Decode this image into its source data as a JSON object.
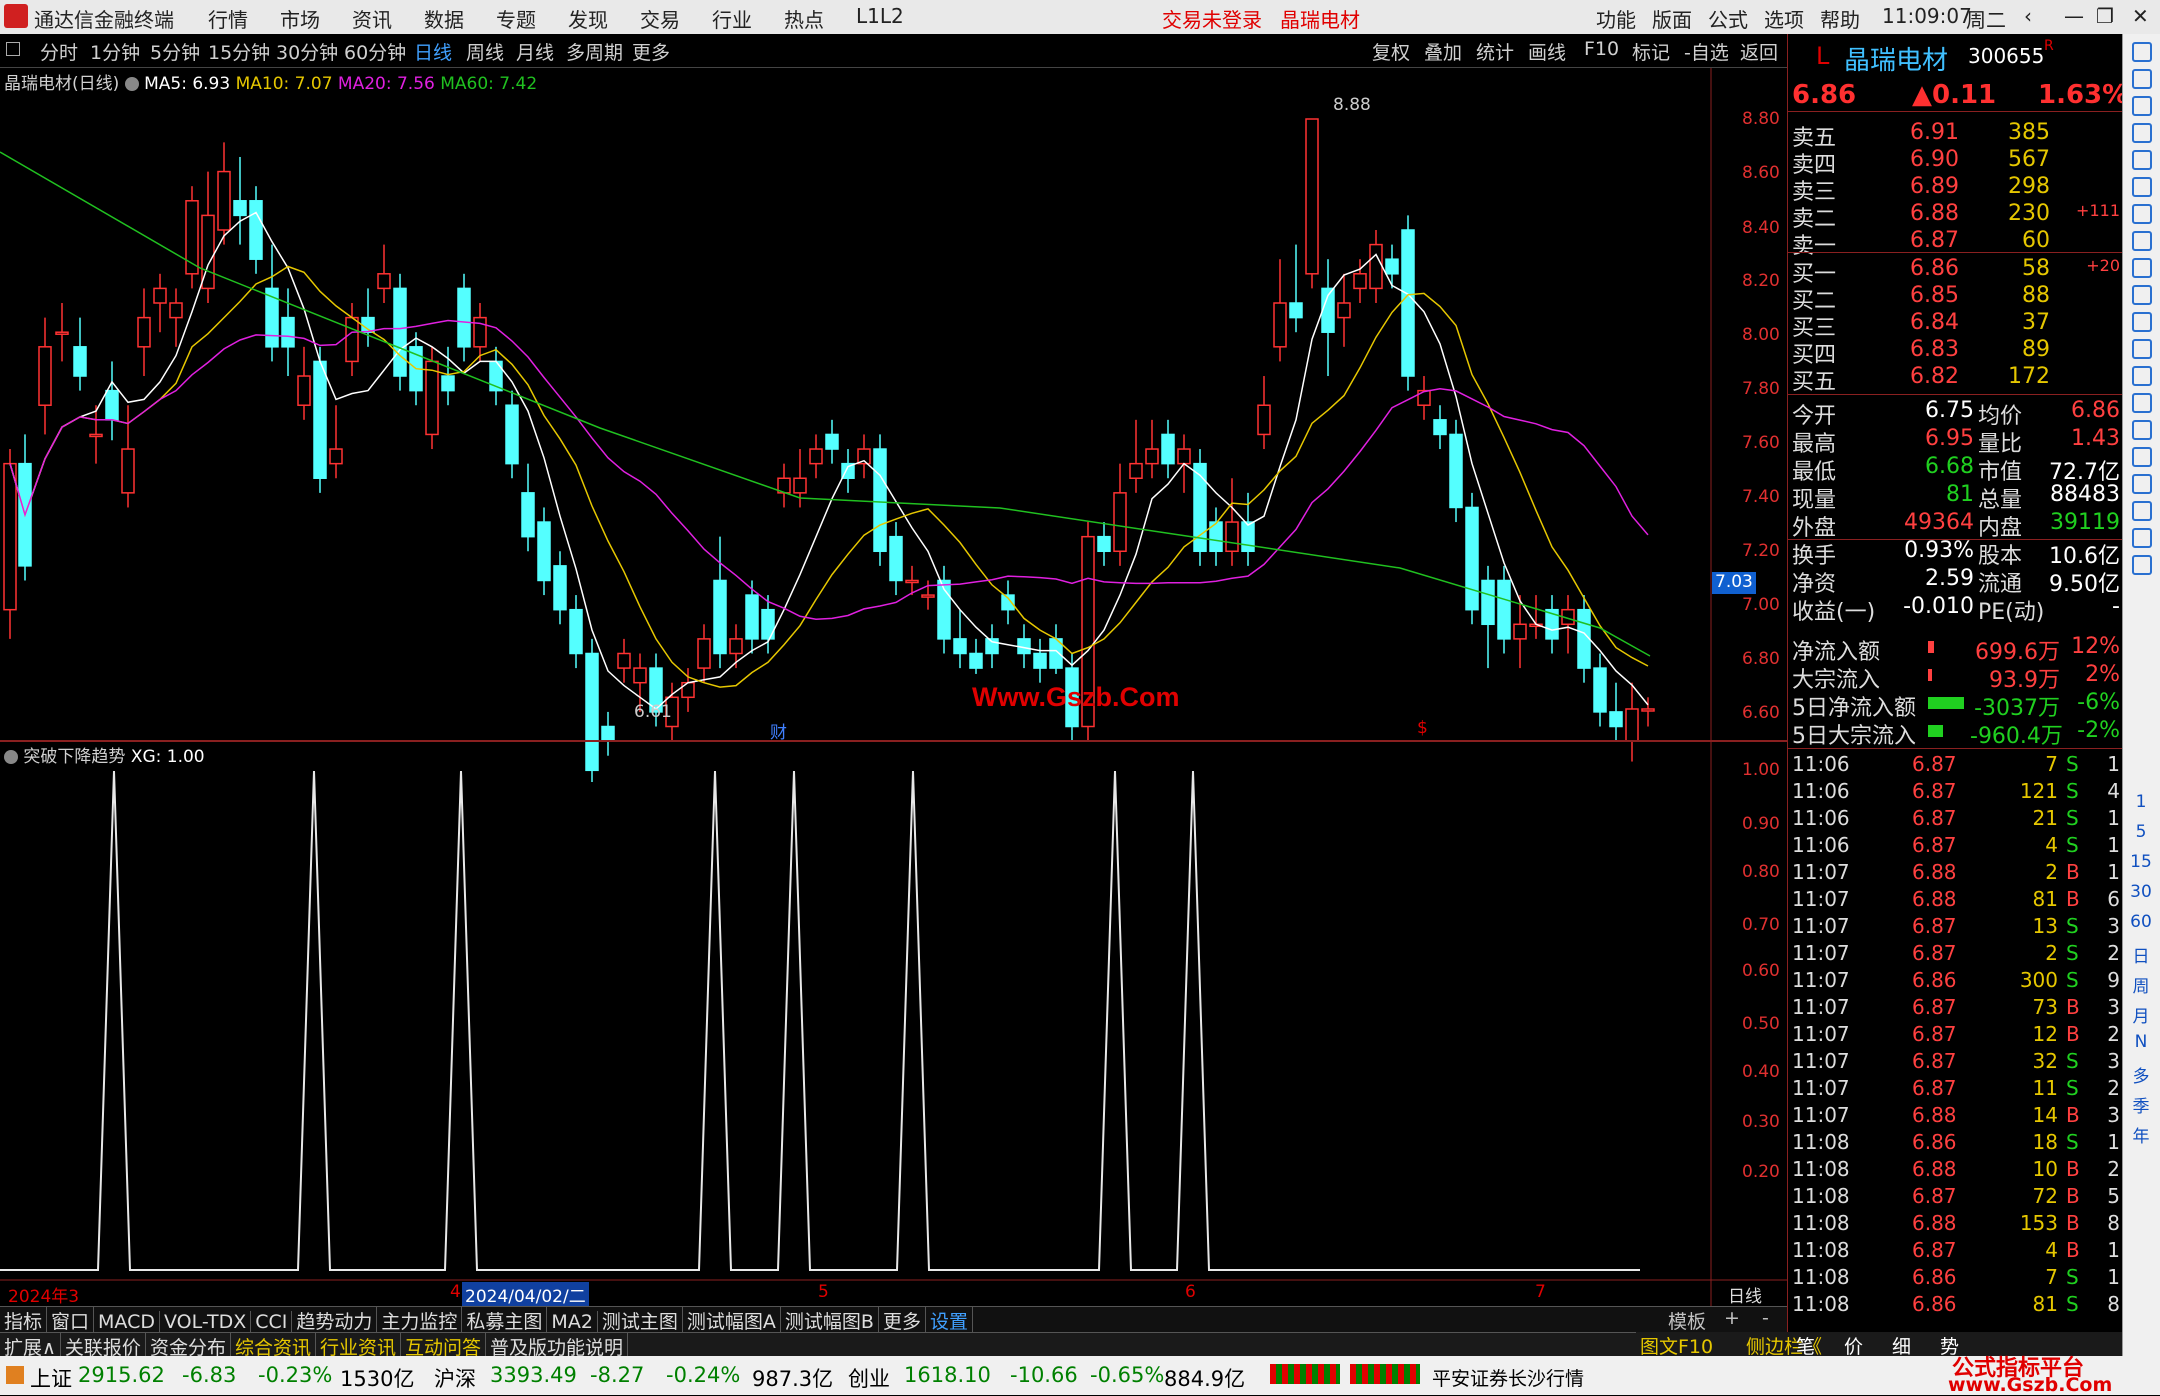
{
  "app": {
    "title": "通达信金融终端",
    "menu": [
      "行情",
      "市场",
      "资讯",
      "数据",
      "专题",
      "发现",
      "交易",
      "行业",
      "热点",
      "L1L2"
    ],
    "login_status": "交易未登录",
    "stock_title": "晶瑞电材",
    "right_menu": [
      "功能",
      "版面",
      "公式",
      "选项",
      "帮助"
    ],
    "clock": "11:09:07",
    "weekday": "周二"
  },
  "periods": [
    "分时",
    "1分钟",
    "5分钟",
    "15分钟",
    "30分钟",
    "60分钟",
    "日线",
    "周线",
    "月线",
    "多周期",
    "更多"
  ],
  "active_period": "日线",
  "chart_tools": [
    "复权",
    "叠加",
    "统计",
    "画线",
    "F10",
    "标记",
    "-自选",
    "返回"
  ],
  "ma_legend": {
    "name": "晶瑞电材(日线)",
    "ma5": "MA5: 6.93",
    "ma10": "MA10: 7.07",
    "ma20": "MA20: 7.56",
    "ma60": "MA60: 7.42",
    "colors": {
      "ma5": "#ffffff",
      "ma10": "#e6c700",
      "ma20": "#e020e0",
      "ma60": "#20c020"
    }
  },
  "price_axis": [
    "8.80",
    "8.60",
    "8.40",
    "8.20",
    "8.00",
    "7.80",
    "7.60",
    "7.40",
    "7.20",
    "7.00",
    "6.80",
    "6.60"
  ],
  "current_price_marker": "7.03",
  "high_label": "8.88",
  "low_label": "6.61",
  "watermark": "Www.Gszb.Com",
  "event_markers": [
    "财",
    "$"
  ],
  "indicator": {
    "title": "突破下降趋势",
    "value_label": "XG: 1.00",
    "axis": [
      "1.00",
      "0.90",
      "0.80",
      "0.70",
      "0.60",
      "0.50",
      "0.40",
      "0.30",
      "0.20"
    ],
    "spike_positions": [
      114,
      314,
      461,
      715,
      794,
      913,
      1115,
      1193
    ]
  },
  "date_axis": {
    "labels": [
      "2024年3",
      "4",
      "2024/04/02/二",
      "5",
      "6",
      "7"
    ],
    "right": "日线"
  },
  "bottom_tabs": [
    "指标",
    "窗口",
    "MACD",
    "VOL-TDX",
    "CCI",
    "趋势动力",
    "主力监控",
    "私募主图",
    "MA2",
    "测试主图",
    "测试幅图A",
    "测试幅图B",
    "更多",
    "设置"
  ],
  "bottom_tabs_right": [
    "模板",
    "+",
    "-"
  ],
  "bottom_tabs2": [
    "扩展∧",
    "关联报价",
    "资金分布",
    "综合资讯",
    "行业资讯",
    "互动问答",
    "普及版功能说明"
  ],
  "bottom_right": [
    "图文F10",
    "侧边栏《",
    "笔",
    "价",
    "细",
    "势"
  ],
  "stock": {
    "prefix": "L",
    "name": "晶瑞电材",
    "code": "300655",
    "flag": "R",
    "price": "6.86",
    "change": "▲0.11",
    "pct": "1.63%"
  },
  "asks": [
    {
      "label": "卖五",
      "price": "6.91",
      "vol": "385",
      "extra": ""
    },
    {
      "label": "卖四",
      "price": "6.90",
      "vol": "567",
      "extra": ""
    },
    {
      "label": "卖三",
      "price": "6.89",
      "vol": "298",
      "extra": ""
    },
    {
      "label": "卖二",
      "price": "6.88",
      "vol": "230",
      "extra": "+111"
    },
    {
      "label": "卖一",
      "price": "6.87",
      "vol": "60",
      "extra": ""
    }
  ],
  "bids": [
    {
      "label": "买一",
      "price": "6.86",
      "vol": "58",
      "extra": "+20"
    },
    {
      "label": "买二",
      "price": "6.85",
      "vol": "88",
      "extra": ""
    },
    {
      "label": "买三",
      "price": "6.84",
      "vol": "37",
      "extra": ""
    },
    {
      "label": "买四",
      "price": "6.83",
      "vol": "89",
      "extra": ""
    },
    {
      "label": "买五",
      "price": "6.82",
      "vol": "172",
      "extra": ""
    }
  ],
  "stats": [
    {
      "l1": "今开",
      "v1": "6.75",
      "l2": "均价",
      "v2": "6.86",
      "c1": "#ffffff",
      "c2": "#ff4040"
    },
    {
      "l1": "最高",
      "v1": "6.95",
      "l2": "量比",
      "v2": "1.43",
      "c1": "#ff4040",
      "c2": "#ff4040"
    },
    {
      "l1": "最低",
      "v1": "6.68",
      "l2": "市值",
      "v2": "72.7亿",
      "c1": "#20d020",
      "c2": "#ffffff"
    },
    {
      "l1": "现量",
      "v1": "81",
      "l2": "总量",
      "v2": "88483",
      "c1": "#20d020",
      "c2": "#ffffff"
    },
    {
      "l1": "外盘",
      "v1": "49364",
      "l2": "内盘",
      "v2": "39119",
      "c1": "#ff4040",
      "c2": "#20d020"
    },
    {
      "l1": "换手",
      "v1": "0.93%",
      "l2": "股本",
      "v2": "10.6亿",
      "c1": "#ffffff",
      "c2": "#ffffff"
    },
    {
      "l1": "净资",
      "v1": "2.59",
      "l2": "流通",
      "v2": "9.50亿",
      "c1": "#ffffff",
      "c2": "#ffffff"
    },
    {
      "l1": "收益(一)",
      "v1": "-0.010",
      "l2": "PE(动)",
      "v2": "-",
      "c1": "#ffffff",
      "c2": "#ffffff"
    }
  ],
  "flows": [
    {
      "label": "净流入额",
      "value": "699.6万",
      "pct": "12%",
      "color": "#ff4040",
      "bar": 0.05
    },
    {
      "label": "大宗流入",
      "value": "93.9万",
      "pct": "2%",
      "color": "#ff4040",
      "bar": 0.01
    },
    {
      "label": "5日净流入额",
      "value": "-3037万",
      "pct": "-6%",
      "color": "#20d020",
      "bar": 0.9
    },
    {
      "label": "5日大宗流入",
      "value": "-960.4万",
      "pct": "-2%",
      "color": "#20d020",
      "bar": 0.3
    }
  ],
  "ticks": [
    {
      "t": "11:06",
      "p": "6.87",
      "v": "7",
      "d": "S",
      "n": "1"
    },
    {
      "t": "11:06",
      "p": "6.87",
      "v": "121",
      "d": "S",
      "n": "4"
    },
    {
      "t": "11:06",
      "p": "6.87",
      "v": "21",
      "d": "S",
      "n": "1"
    },
    {
      "t": "11:06",
      "p": "6.87",
      "v": "4",
      "d": "S",
      "n": "1"
    },
    {
      "t": "11:07",
      "p": "6.88",
      "v": "2",
      "d": "B",
      "n": "1"
    },
    {
      "t": "11:07",
      "p": "6.88",
      "v": "81",
      "d": "B",
      "n": "6"
    },
    {
      "t": "11:07",
      "p": "6.87",
      "v": "13",
      "d": "S",
      "n": "3"
    },
    {
      "t": "11:07",
      "p": "6.87",
      "v": "2",
      "d": "S",
      "n": "2"
    },
    {
      "t": "11:07",
      "p": "6.86",
      "v": "300",
      "d": "S",
      "n": "9"
    },
    {
      "t": "11:07",
      "p": "6.87",
      "v": "73",
      "d": "B",
      "n": "3"
    },
    {
      "t": "11:07",
      "p": "6.87",
      "v": "12",
      "d": "B",
      "n": "2"
    },
    {
      "t": "11:07",
      "p": "6.87",
      "v": "32",
      "d": "S",
      "n": "3"
    },
    {
      "t": "11:07",
      "p": "6.87",
      "v": "11",
      "d": "S",
      "n": "2"
    },
    {
      "t": "11:07",
      "p": "6.88",
      "v": "14",
      "d": "B",
      "n": "3"
    },
    {
      "t": "11:08",
      "p": "6.86",
      "v": "18",
      "d": "S",
      "n": "1"
    },
    {
      "t": "11:08",
      "p": "6.88",
      "v": "10",
      "d": "B",
      "n": "2"
    },
    {
      "t": "11:08",
      "p": "6.87",
      "v": "72",
      "d": "B",
      "n": "5"
    },
    {
      "t": "11:08",
      "p": "6.88",
      "v": "153",
      "d": "B",
      "n": "8"
    },
    {
      "t": "11:08",
      "p": "6.87",
      "v": "4",
      "d": "B",
      "n": "1"
    },
    {
      "t": "11:08",
      "p": "6.86",
      "v": "7",
      "d": "S",
      "n": "1"
    },
    {
      "t": "11:08",
      "p": "6.86",
      "v": "81",
      "d": "S",
      "n": "8"
    }
  ],
  "side_icons": [
    "up-arrow-icon",
    "up-icon",
    "down-icon",
    "grid-icon",
    "table-icon",
    "line-icon",
    "bar-icon",
    "list-icon",
    "f10-icon",
    "doc-icon",
    "list2-icon",
    "fs-icon",
    "circle-icon",
    "chart-icon",
    "wave-icon",
    "rsi-icon",
    "move-icon",
    "pen-icon",
    "fs2-icon",
    "grid2-icon"
  ],
  "side_text": [
    "1",
    "5",
    "15",
    "30",
    "60",
    "日",
    "周",
    "月",
    "N",
    "多",
    "季",
    "年"
  ],
  "status": {
    "sh_name": "上证",
    "sh_val": "2915.62",
    "sh_chg": "-6.83",
    "sh_pct": "-0.23%",
    "sh_amt": "1530亿",
    "sz_name": "沪深",
    "sz_val": "3393.49",
    "sz_chg": "-8.27",
    "sz_pct": "-0.24%",
    "sz_amt": "987.3亿",
    "cy_name": "创业",
    "cy_val": "1618.10",
    "cy_chg": "-10.66",
    "cy_pct": "-0.65%",
    "cy_amt": "884.9亿",
    "broker": "平安证券长沙行情",
    "brand1": "公式指标平台",
    "brand2": "www.Gszb.Com"
  },
  "chart_data": {
    "type": "candlestick",
    "note_ma": [
      "MA5",
      "MA10",
      "MA20",
      "MA60"
    ],
    "ylim": [
      6.6,
      8.88
    ]
  }
}
